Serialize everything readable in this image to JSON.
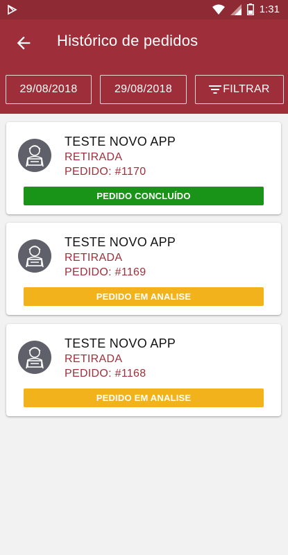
{
  "status_bar": {
    "time": "1:31"
  },
  "app_bar": {
    "title": "Histórico de pedidos"
  },
  "filters": {
    "date_from": "29/08/2018",
    "date_to": "29/08/2018",
    "filter_label": "FILTRAR"
  },
  "colors": {
    "primary": "#9e2f3a",
    "status_done": "#1a9418",
    "status_analysis": "#f2b21b"
  },
  "orders": [
    {
      "name": "TESTE NOVO APP",
      "type": "RETIRADA",
      "order": "PEDIDO: #1170",
      "status": "PEDIDO CONCLUÍDO",
      "status_color": "#1a9418"
    },
    {
      "name": "TESTE NOVO APP",
      "type": "RETIRADA",
      "order": "PEDIDO: #1169",
      "status": "PEDIDO EM ANALISE",
      "status_color": "#f2b21b"
    },
    {
      "name": "TESTE NOVO APP",
      "type": "RETIRADA",
      "order": "PEDIDO: #1168",
      "status": "PEDIDO EM ANALISE",
      "status_color": "#f2b21b"
    }
  ]
}
